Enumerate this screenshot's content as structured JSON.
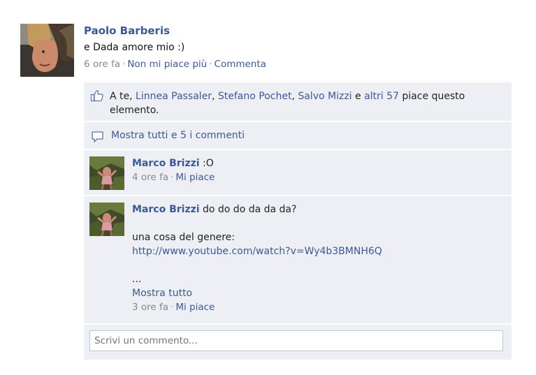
{
  "post": {
    "author": "Paolo Barberis",
    "text": "e Dada amore mio :)",
    "time": "6 ore fa",
    "sep": "·",
    "unlike": "Non mi piace più",
    "comment_action": "Commenta"
  },
  "likes": {
    "you": "A te",
    "comma1": ", ",
    "person1": "Linnea Passaler",
    "comma2": ", ",
    "person2": "Stefano Pochet",
    "comma3": ", ",
    "person3": "Salvo Mizzi",
    "and": " e ",
    "others": "altri 57",
    "suffix": " piace questo elemento."
  },
  "show_all_comments": "Mostra tutti e 5 i commenti",
  "comments": [
    {
      "author": "Marco Brizzi",
      "text": ":O",
      "time": "4 ore fa",
      "sep": "·",
      "like": "Mi piace"
    },
    {
      "author": "Marco Brizzi",
      "text": "do do do da da da?",
      "line2": "una cosa del genere:",
      "url": "http://www.youtube.com/watch?v=Wy4b3BMNH6Q",
      "ellipsis": "...",
      "show_more": "Mostra tutto",
      "time": "3 ore fa",
      "sep": "·",
      "like": "Mi piace"
    }
  ],
  "composer": {
    "placeholder": "Scrivi un commento..."
  },
  "colors": {
    "link": "#3b5998",
    "ufi_bg": "#edeff4",
    "meta": "#888888"
  }
}
